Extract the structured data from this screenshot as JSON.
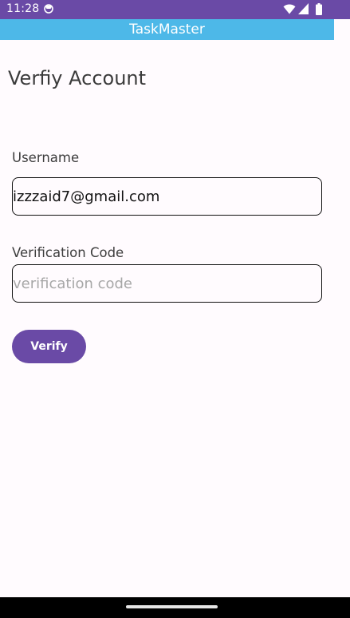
{
  "status_bar": {
    "time": "11:28",
    "icons": [
      "app-notification-icon",
      "wifi-icon",
      "signal-icon",
      "battery-icon"
    ]
  },
  "app_bar": {
    "title": "TaskMaster"
  },
  "page": {
    "title": "Verfiy Account"
  },
  "form": {
    "username": {
      "label": "Username",
      "value": "izzzaid7@gmail.com"
    },
    "verification_code": {
      "label": "Verification Code",
      "value": "",
      "placeholder": "verification code"
    },
    "submit_label": "Verify"
  },
  "colors": {
    "status_bar": "#6a4aa6",
    "app_bar": "#4db8e8",
    "primary_button": "#6a4aa6",
    "background": "#fffbfe"
  }
}
